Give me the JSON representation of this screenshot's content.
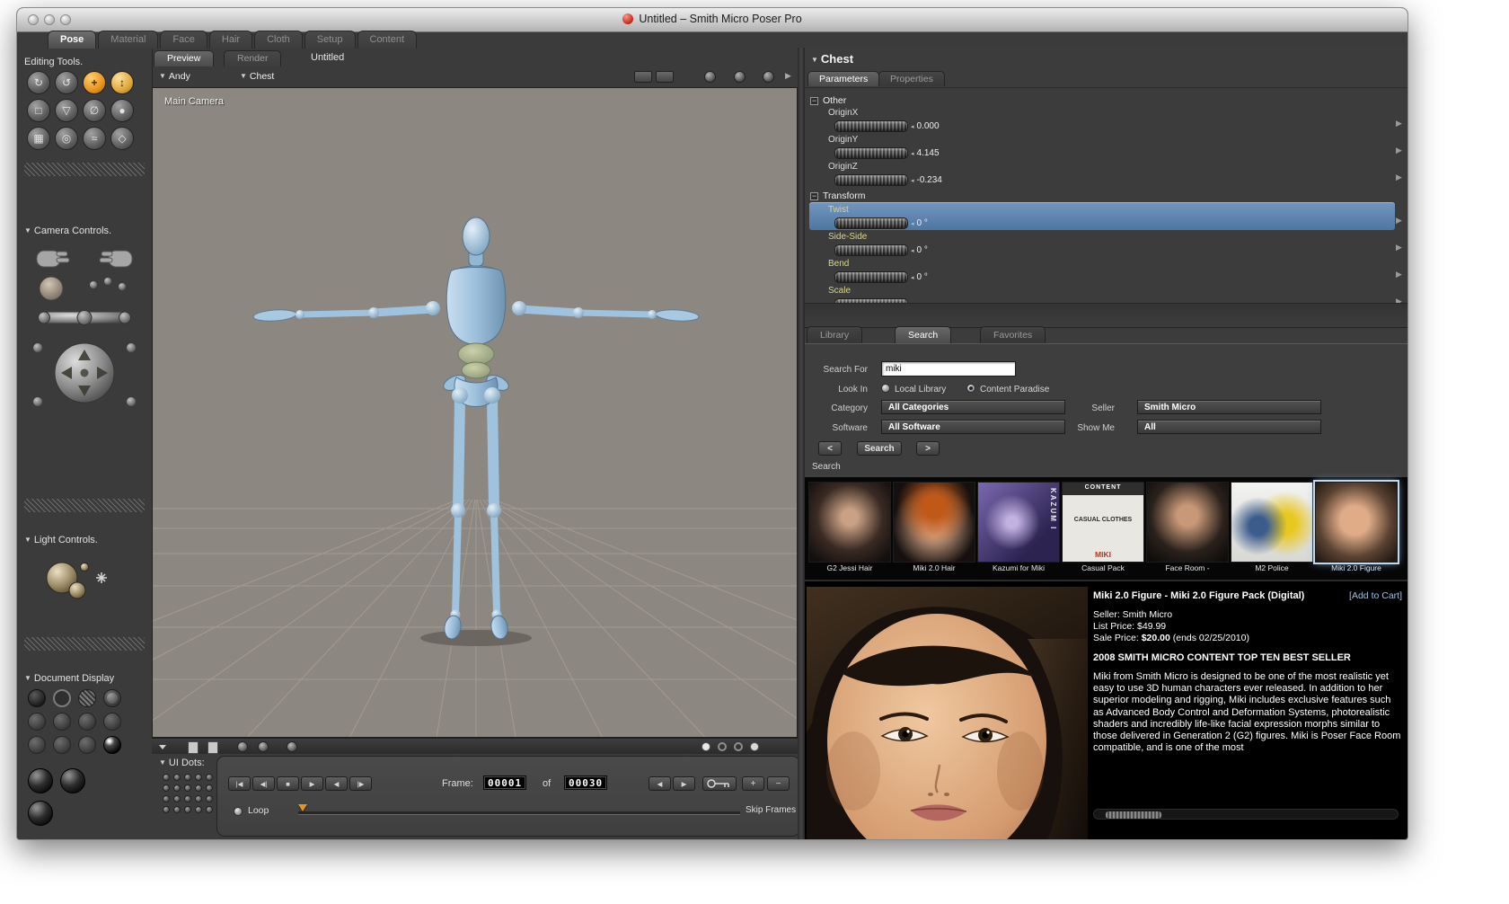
{
  "icons": {
    "disclosure": "▼",
    "collapse": "−",
    "row_arrow": "▶",
    "header_arrow": "▶",
    "dial_cap": "◂",
    "transport_left": [
      "|◀",
      "◀|",
      "■",
      "▶",
      "◀",
      "|▶"
    ],
    "transport_prev": "◀",
    "transport_next": "▶",
    "plus": "+",
    "minus": "−",
    "tools": [
      "↻",
      "↺",
      "+",
      "↕",
      "□",
      "▽",
      "∅",
      "●",
      "▦",
      "◎",
      "≈",
      "◇"
    ]
  },
  "titlebar": {
    "title": "Untitled – Smith Micro Poser Pro"
  },
  "room_tabs": {
    "items": [
      {
        "label": "Pose"
      },
      {
        "label": "Material"
      },
      {
        "label": "Face"
      },
      {
        "label": "Hair"
      },
      {
        "label": "Cloth"
      },
      {
        "label": "Setup"
      },
      {
        "label": "Content"
      }
    ],
    "active": "Pose"
  },
  "sidebar": {
    "editing_tools_title": "Editing Tools.",
    "camera_controls_title": "Camera Controls.",
    "light_controls_title": "Light Controls.",
    "document_display_title": "Document Display"
  },
  "document": {
    "view_tabs": [
      {
        "label": "Preview"
      },
      {
        "label": "Render"
      }
    ],
    "active_view_tab": "Preview",
    "doc_name": "Untitled",
    "figure_menu": "Andy",
    "actor_menu": "Chest",
    "camera_name": "Main Camera"
  },
  "timeline": {
    "ui_dots_label": "UI Dots:",
    "frame_label": "Frame:",
    "current_frame": "00001",
    "of_label": "of",
    "total_frames": "00030",
    "loop_label": "Loop",
    "skip_frames_label": "Skip Frames"
  },
  "parameters": {
    "actor_title": "Chest",
    "tabs": [
      {
        "label": "Parameters"
      },
      {
        "label": "Properties"
      }
    ],
    "active_tab": "Parameters",
    "selected_param": "Twist",
    "groups": [
      {
        "name": "Other",
        "params": [
          {
            "label": "OriginX",
            "value": "0.000"
          },
          {
            "label": "OriginY",
            "value": "4.145"
          },
          {
            "label": "OriginZ",
            "value": "-0.234"
          }
        ]
      },
      {
        "name": "Transform",
        "params": [
          {
            "label": "Twist",
            "value": "0 °"
          },
          {
            "label": "Side-Side",
            "value": "0 °"
          },
          {
            "label": "Bend",
            "value": "0 °"
          },
          {
            "label": "Scale",
            "value": ""
          }
        ]
      }
    ]
  },
  "library": {
    "tabs": [
      {
        "label": "Library"
      },
      {
        "label": "Search"
      },
      {
        "label": "Favorites"
      }
    ],
    "active_tab": "Search",
    "form": {
      "search_for_label": "Search For",
      "search_value": "miki",
      "look_in_label": "Look In",
      "local_library_label": "Local Library",
      "content_paradise_label": "Content Paradise",
      "look_in_selected": "Content Paradise",
      "category_label": "Category",
      "category_value": "All Categories",
      "seller_label": "Seller",
      "seller_value": "Smith Micro",
      "software_label": "Software",
      "software_value": "All Software",
      "show_me_label": "Show Me",
      "show_me_value": "All",
      "prev_label": "<",
      "search_button_label": "Search",
      "next_label": ">"
    },
    "results_section_label": "Search",
    "results": [
      {
        "label": "G2 Jessi Hair"
      },
      {
        "label": "Miki 2.0 Hair"
      },
      {
        "label": "Kazumi for Miki"
      },
      {
        "label": "Casual Pack"
      },
      {
        "label": "Face Room -"
      },
      {
        "label": "M2 Police"
      },
      {
        "label": "Miki 2.0 Figure"
      }
    ],
    "selected_result": "Miki 2.0 Figure",
    "kazumi_overlay": "KAZUM I",
    "casual_overlay": {
      "line1": "CONTENT",
      "line2": "CASUAL CLOTHES",
      "line3": "MIKI"
    }
  },
  "product": {
    "title": "Miki 2.0 Figure - Miki 2.0 Figure Pack (Digital)",
    "add_to_cart_label": "[Add to Cart]",
    "seller_line": "Seller: Smith Micro",
    "list_price_line": "List Price: $49.99",
    "sale_price_prefix": "Sale Price: ",
    "sale_price_amount": "$20.00",
    "sale_price_suffix": " (ends 02/25/2010)",
    "top_seller_line": "2008 SMITH MICRO CONTENT TOP TEN BEST SELLER",
    "description": "Miki from Smith Micro is designed to be one of the most realistic yet easy to use 3D human characters ever released. In addition to her superior modeling and rigging, Miki includes exclusive features such as Advanced Body Control and Deformation Systems, photorealistic shaders and incredibly life-like facial expression morphs similar to those delivered in Generation 2 (G2) figures. Miki is Poser Face Room compatible, and is one of the most"
  }
}
